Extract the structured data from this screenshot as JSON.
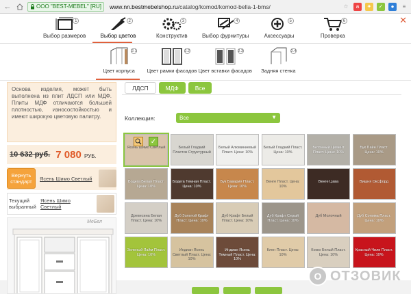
{
  "browser": {
    "back": "←",
    "cert": "ООО \"BEST-MEBEL\" [RU]",
    "url_host": "www.nn.bestmebelshop.ru",
    "url_path": "/catalog/komod/komod-bella-1-bms/"
  },
  "steps": [
    {
      "num": "1",
      "label": "Выбор размеров",
      "icon": "dimensions-icon"
    },
    {
      "num": "2",
      "label": "Выбор цветов",
      "icon": "palette-icon"
    },
    {
      "num": "3",
      "label": "Конструктив",
      "icon": "gears-icon"
    },
    {
      "num": "4",
      "label": "Выбор фурнитуры",
      "icon": "hardware-icon"
    },
    {
      "num": "5",
      "label": "Аксессуары",
      "icon": "plus-circle-icon"
    },
    {
      "num": "6",
      "label": "Проверка",
      "icon": "cart-icon"
    }
  ],
  "substeps": [
    {
      "num": "2.1",
      "label": "Цвет корпуса"
    },
    {
      "num": "2.2",
      "label": "Цвет рамки фасадов"
    },
    {
      "num": "2.3",
      "label": "Цвет вставки фасадов"
    },
    {
      "num": "2.4",
      "label": "Задняя стенка"
    }
  ],
  "description": "Основа изделия, может быть выполнена из плит ЛДСП или МДФ. Плиты МДФ отличаются большей плотностью, износостойкостью и имеют широкую цветовую палитру.",
  "price": {
    "old": "10 632 руб.",
    "new": "7 080",
    "currency": "РУБ."
  },
  "standard": {
    "button": "Вернуть стандарт",
    "label": "Ясень Шимо Светлый"
  },
  "current": {
    "label": "Текущий выбранный",
    "value": "Ясень Шимо Светлый"
  },
  "preview_badge": "МеБел",
  "tabs": [
    "ЛДСП",
    "МДФ",
    "Все"
  ],
  "collection": {
    "label": "Коллекция:",
    "value": "Все"
  },
  "swatches": [
    {
      "name": "Ясень Шимо Светлый",
      "color": "#d9c4ab",
      "light": true,
      "selected": true
    },
    {
      "name": "Белый Гладкий Пластик Структурный",
      "color": "#d8d6d0",
      "light": true
    },
    {
      "name": "Белый Алюминиевый Пласт. Цена: 10%",
      "color": "#f0f0ee",
      "light": true
    },
    {
      "name": "Белый Гладкий Пласт. Цена: 10%",
      "color": "#ecebe7",
      "light": true
    },
    {
      "name": "Бетонный Цемент Пласт. Цена: 10%",
      "color": "#b3b0a8"
    },
    {
      "name": "Бук Пайн Пласт. Цена: 10%",
      "color": "#a99a86"
    },
    {
      "name": "Бодега Белая Пласт. Цена: 10%",
      "color": "#b6a893"
    },
    {
      "name": "Бодега Темная Пласт. Цена: 10%",
      "color": "#4f3a2f"
    },
    {
      "name": "Бук Бавария Пласт. Цена: 10%",
      "color": "#c7874c"
    },
    {
      "name": "Венге Пласт. Цена: 10%",
      "color": "#e3c79c",
      "light": true
    },
    {
      "name": "Венге Цава",
      "color": "#3d2b24"
    },
    {
      "name": "Вишня Оксфорд",
      "color": "#b15a33"
    },
    {
      "name": "Древесина Белая Пласт. Цена: 10%",
      "color": "#d4cfc6",
      "light": true
    },
    {
      "name": "Дуб Золотой Крафт Пласт. Цена: 10%",
      "color": "#a8835a"
    },
    {
      "name": "Дуб Крафт Белый Пласт. Цена: 10%",
      "color": "#d8ccb6",
      "light": true
    },
    {
      "name": "Дуб Крафт Серый Пласт. Цена: 10%",
      "color": "#9c958a"
    },
    {
      "name": "Дуб Молочный",
      "color": "#d5b9a3",
      "light": true
    },
    {
      "name": "Дуб Сонома Пласт. Цена: 10%",
      "color": "#c2a07c"
    },
    {
      "name": "Зеленый Лайм Пласт. Цена: 10%",
      "color": "#a3c43b"
    },
    {
      "name": "Индиан Ясень Светлый Пласт. Цена: 10%",
      "color": "#d6c39f",
      "light": true
    },
    {
      "name": "Индиан Ясень Темный Пласт. Цена: 10%",
      "color": "#6d4b3a"
    },
    {
      "name": "Клен Пласт. Цена: 10%",
      "color": "#e0cba8",
      "light": true
    },
    {
      "name": "Кокко Белый Пласт. Цена: 10%",
      "color": "#d9cfbf",
      "light": true
    },
    {
      "name": "Красный Чили Пласт. Цена: 10%",
      "color": "#c8141c"
    }
  ],
  "watermark": {
    "mark": "O",
    "text": "ОТЗОВИК"
  }
}
